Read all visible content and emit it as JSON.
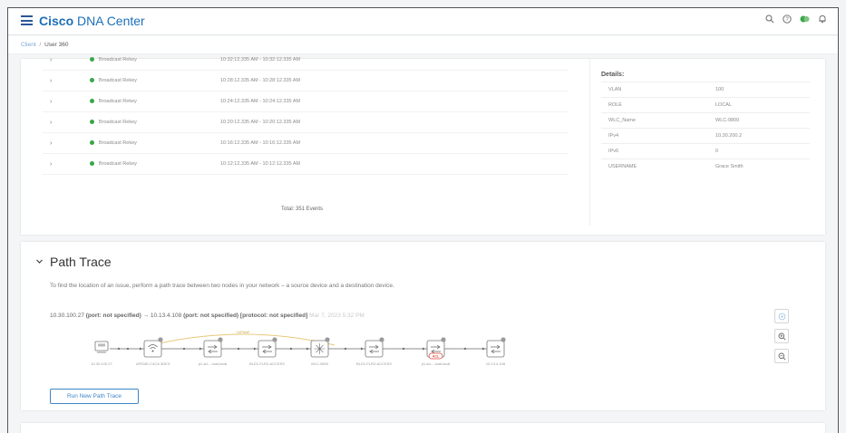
{
  "header": {
    "brand_bold": "Cisco",
    "brand_rest": " DNA Center",
    "icons": [
      "search-icon",
      "help-icon",
      "status-icon",
      "notifications-icon"
    ]
  },
  "breadcrumb": {
    "link": "Client",
    "separator": "/",
    "current": "User 360"
  },
  "events": {
    "rows": [
      {
        "name": "Broadcast Rekey",
        "time": "10:32:12.335 AM - 10:32:12.335 AM"
      },
      {
        "name": "Broadcast Rekey",
        "time": "10:28:12.335 AM - 10:28:12.335 AM"
      },
      {
        "name": "Broadcast Rekey",
        "time": "10:24:12.335 AM - 10:24:12.335 AM"
      },
      {
        "name": "Broadcast Rekey",
        "time": "10:20:12.335 AM - 10:20:12.335 AM"
      },
      {
        "name": "Broadcast Rekey",
        "time": "10:16:12.335 AM - 10:16:12.335 AM"
      },
      {
        "name": "Broadcast Rekey",
        "time": "10:12:12.335 AM - 10:12:12.335 AM"
      }
    ],
    "total": "Total: 351 Events"
  },
  "details": {
    "title": "Details:",
    "rows": [
      {
        "key": "VLAN",
        "value": "100"
      },
      {
        "key": "ROLE",
        "value": "LOCAL"
      },
      {
        "key": "WLC_Name",
        "value": "WLC-9800"
      },
      {
        "key": "IPv4",
        "value": "10.30.200.2"
      },
      {
        "key": "IPv6",
        "value": "0"
      },
      {
        "key": "USERNAME",
        "value": "Grace Smith"
      }
    ]
  },
  "path_trace": {
    "title": "Path Trace",
    "description": "To find the location of an issue, perform a path trace between two nodes in your network – a source device and a destination device.",
    "source": "10.30.100.27",
    "source_port": "(port: not specified)",
    "arrow": "→",
    "destination": "10.13.4.108",
    "dest_port": "(port: not specified)",
    "protocol": "[protocol: not specified]",
    "date": "Mar 7, 2023 5:32 PM",
    "capwap_label": "CAPWAP",
    "acl_label": "ACL",
    "nodes": [
      {
        "label": "10.30.100.27",
        "icon": "client-host-icon"
      },
      {
        "label": "AP0081.C4CA.3DE3",
        "icon": "access-point-icon"
      },
      {
        "label": "p1.ad.....taat.local",
        "icon": "switch-icon"
      },
      {
        "label": "BLD1-FLR2-ACCESS",
        "icon": "switch-icon"
      },
      {
        "label": "WLC-9800",
        "icon": "wireless-controller-icon"
      },
      {
        "label": "BLD1-FLR2-ACCESS",
        "icon": "switch-icon"
      },
      {
        "label": "p1.ad.....taat.local",
        "icon": "switch-icon"
      },
      {
        "label": "10.13.4.108",
        "icon": "switch-icon"
      }
    ],
    "run_button": "Run New Path Trace",
    "side_controls": [
      "settings-icon",
      "zoom-in-icon",
      "zoom-out-icon"
    ]
  },
  "colors": {
    "accent": "#1d6fb8",
    "status_green": "#3aa64a",
    "acl_red": "#e04a3b"
  }
}
